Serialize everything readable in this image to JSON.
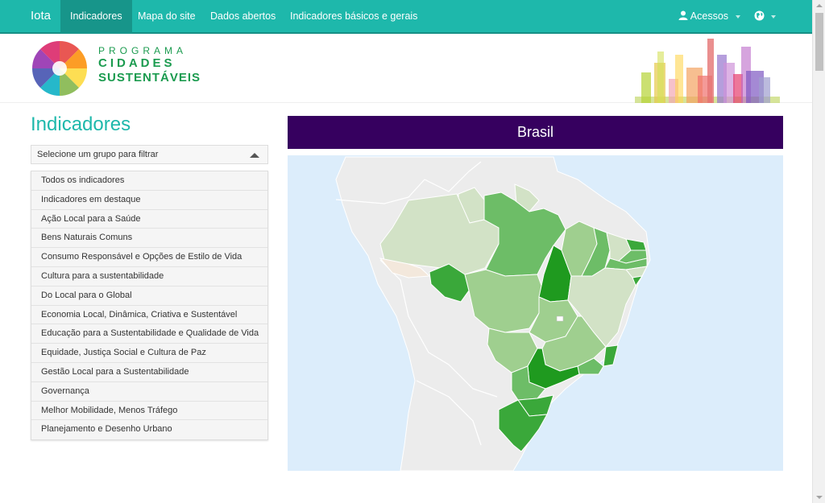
{
  "nav": {
    "brand": "Iota",
    "items": [
      {
        "label": "Indicadores",
        "active": true
      },
      {
        "label": "Mapa do site",
        "active": false
      },
      {
        "label": "Dados abertos",
        "active": false
      },
      {
        "label": "Indicadores básicos e gerais",
        "active": false
      }
    ],
    "acessos_label": "Acessos",
    "user_icon": "user-icon",
    "globe_icon": "globe-icon"
  },
  "logo": {
    "line1": "PROGRAMA",
    "line2": "CIDADES",
    "line3": "SUSTENTÁVEIS"
  },
  "sidebar": {
    "title": "Indicadores",
    "filter_placeholder": "Selecione um grupo para filtrar",
    "groups": [
      "Todos os indicadores",
      "Indicadores em destaque",
      "Ação Local para a Saúde",
      "Bens Naturais Comuns",
      "Consumo Responsável e Opções de Estilo de Vida",
      "Cultura para a sustentabilidade",
      "Do Local para o Global",
      "Economia Local, Dinâmica, Criativa e Sustentável",
      "Educação para a Sustentabilidade e Qualidade de Vida",
      "Equidade, Justiça Social e Cultura de Paz",
      "Gestão Local para a Sustentabilidade",
      "Governança",
      "Melhor Mobilidade, Menos Tráfego",
      "Planejamento e Desenho Urbano"
    ]
  },
  "map": {
    "title": "Brasil",
    "colors": {
      "ocean": "#dcedfb",
      "land": "#ececec",
      "light": "#d2e2c6",
      "mid": "#9fcf8f",
      "green": "#6dbd67",
      "strong": "#3aa83a",
      "dark": "#1f9a1f"
    }
  },
  "colors": {
    "navbar": "#1eb8ab",
    "nav_active": "#17958a",
    "title_bar": "#36005f",
    "accent": "#1eb8ab",
    "logo_green": "#1b9b4f"
  }
}
